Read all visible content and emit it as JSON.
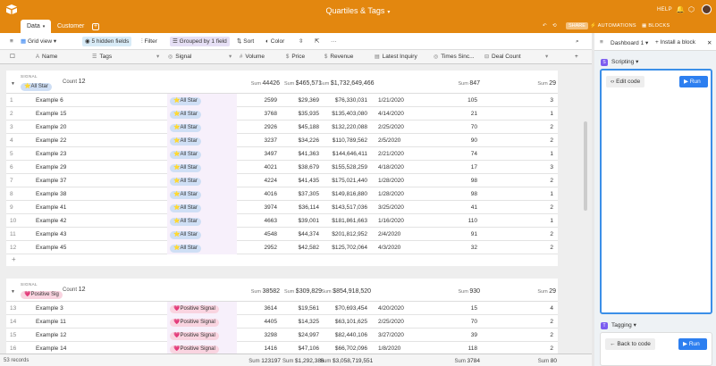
{
  "app": {
    "title": "Quartiles & Tags",
    "help_label": "HELP",
    "tabs": [
      {
        "label": "Data"
      },
      {
        "label": "Customer"
      }
    ],
    "share_label": "SHARE",
    "automations_label": "AUTOMATIONS",
    "blocks_label": "BLOCKS",
    "accent_color": "#e3870f"
  },
  "toolbar": {
    "view_label": "Grid view",
    "hidden_fields": "5 hidden fields",
    "filter": "Filter",
    "grouped": "Grouped by 1 field",
    "sort": "Sort",
    "color": "Color"
  },
  "columns": [
    "Name",
    "Tags",
    "Signal",
    "Volume",
    "Price",
    "Revenue",
    "Latest Inquiry",
    "Times Sinc...",
    "Deal Count"
  ],
  "groups": [
    {
      "field_label": "SIGNAL",
      "name": "All Star",
      "count_label": "Count",
      "count": "12",
      "sums": {
        "volume": "44426",
        "price": "$465,571",
        "revenue": "$1,732,649,466",
        "times": "847",
        "deals": "29"
      },
      "sum_label": "Sum",
      "rows": [
        {
          "num": "1",
          "name": "Example 6",
          "signal": "All Star",
          "volume": "2599",
          "price": "$29,369",
          "revenue": "$76,330,031",
          "date": "1/21/2020",
          "times": "105",
          "deals": "3"
        },
        {
          "num": "2",
          "name": "Example 15",
          "signal": "All Star",
          "volume": "3768",
          "price": "$35,935",
          "revenue": "$135,403,080",
          "date": "4/14/2020",
          "times": "21",
          "deals": "1"
        },
        {
          "num": "3",
          "name": "Example 20",
          "signal": "All Star",
          "volume": "2926",
          "price": "$45,188",
          "revenue": "$132,220,088",
          "date": "2/25/2020",
          "times": "70",
          "deals": "2"
        },
        {
          "num": "4",
          "name": "Example 22",
          "signal": "All Star",
          "volume": "3237",
          "price": "$34,226",
          "revenue": "$110,789,562",
          "date": "2/5/2020",
          "times": "90",
          "deals": "2"
        },
        {
          "num": "5",
          "name": "Example 23",
          "signal": "All Star",
          "volume": "3497",
          "price": "$41,363",
          "revenue": "$144,646,411",
          "date": "2/21/2020",
          "times": "74",
          "deals": "1"
        },
        {
          "num": "6",
          "name": "Example 29",
          "signal": "All Star",
          "volume": "4021",
          "price": "$38,679",
          "revenue": "$155,528,259",
          "date": "4/18/2020",
          "times": "17",
          "deals": "3"
        },
        {
          "num": "7",
          "name": "Example 37",
          "signal": "All Star",
          "volume": "4224",
          "price": "$41,435",
          "revenue": "$175,021,440",
          "date": "1/28/2020",
          "times": "98",
          "deals": "2"
        },
        {
          "num": "8",
          "name": "Example 38",
          "signal": "All Star",
          "volume": "4016",
          "price": "$37,305",
          "revenue": "$149,816,880",
          "date": "1/28/2020",
          "times": "98",
          "deals": "1"
        },
        {
          "num": "9",
          "name": "Example 41",
          "signal": "All Star",
          "volume": "3974",
          "price": "$36,114",
          "revenue": "$143,517,036",
          "date": "3/25/2020",
          "times": "41",
          "deals": "2"
        },
        {
          "num": "10",
          "name": "Example 42",
          "signal": "All Star",
          "volume": "4663",
          "price": "$39,001",
          "revenue": "$181,861,663",
          "date": "1/16/2020",
          "times": "110",
          "deals": "1"
        },
        {
          "num": "11",
          "name": "Example 43",
          "signal": "All Star",
          "volume": "4548",
          "price": "$44,374",
          "revenue": "$201,812,952",
          "date": "2/4/2020",
          "times": "91",
          "deals": "2"
        },
        {
          "num": "12",
          "name": "Example 45",
          "signal": "All Star",
          "volume": "2952",
          "price": "$42,582",
          "revenue": "$125,702,064",
          "date": "4/3/2020",
          "times": "32",
          "deals": "2"
        }
      ]
    },
    {
      "field_label": "SIGNAL",
      "name": "Positive Sig",
      "count_label": "Count",
      "count": "12",
      "sums": {
        "volume": "38582",
        "price": "$309,829",
        "revenue": "$854,918,520",
        "times": "930",
        "deals": "29"
      },
      "sum_label": "Sum",
      "rows": [
        {
          "num": "13",
          "name": "Example 3",
          "signal": "Positive Signal",
          "volume": "3614",
          "price": "$19,561",
          "revenue": "$70,693,454",
          "date": "4/20/2020",
          "times": "15",
          "deals": "4"
        },
        {
          "num": "14",
          "name": "Example 11",
          "signal": "Positive Signal",
          "volume": "4405",
          "price": "$14,325",
          "revenue": "$63,101,625",
          "date": "2/25/2020",
          "times": "70",
          "deals": "2"
        },
        {
          "num": "15",
          "name": "Example 12",
          "signal": "Positive Signal",
          "volume": "3298",
          "price": "$24,997",
          "revenue": "$82,440,106",
          "date": "3/27/2020",
          "times": "39",
          "deals": "2"
        },
        {
          "num": "16",
          "name": "Example 14",
          "signal": "Positive Signal",
          "volume": "1416",
          "price": "$47,106",
          "revenue": "$66,702,096",
          "date": "1/8/2020",
          "times": "118",
          "deals": "2"
        }
      ]
    }
  ],
  "footer": {
    "records": "53 records",
    "sum_label": "Sum",
    "volume": "123197",
    "price": "$1,292,386",
    "revenue": "$3,058,719,551",
    "times": "3784",
    "deals": "80"
  },
  "panel": {
    "dashboard": "Dashboard 1",
    "install": "Install a block",
    "blocks": [
      {
        "name": "Scripting",
        "left_btn": "Edit code",
        "run": "Run"
      },
      {
        "name": "Tagging",
        "left_btn": "Back to code",
        "run": "Run"
      }
    ]
  }
}
